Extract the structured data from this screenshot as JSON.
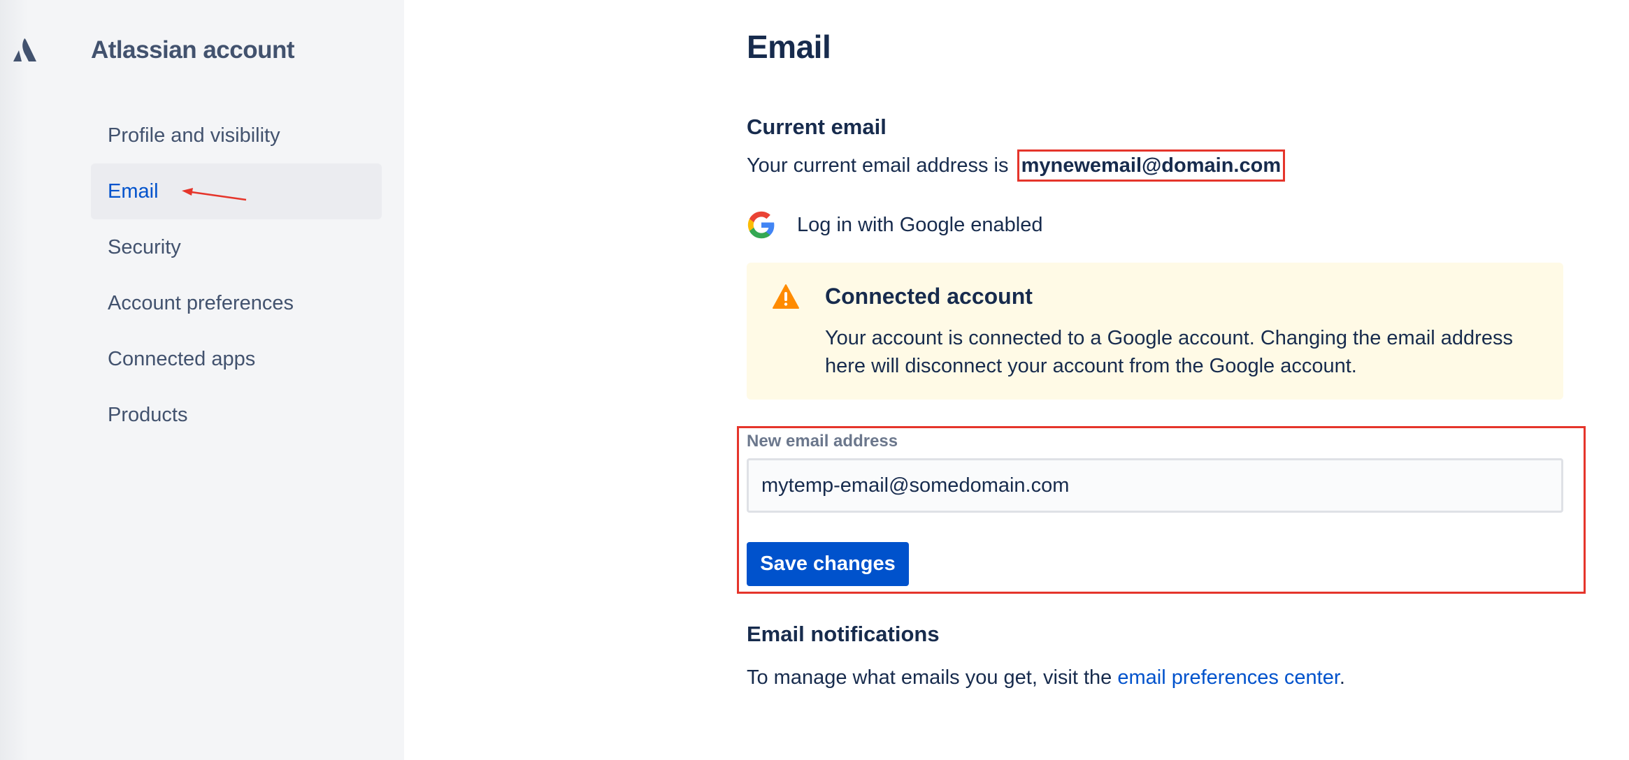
{
  "sidebar": {
    "brand": "Atlassian account",
    "items": [
      {
        "label": "Profile and visibility"
      },
      {
        "label": "Email",
        "active": true
      },
      {
        "label": "Security"
      },
      {
        "label": "Account preferences"
      },
      {
        "label": "Connected apps"
      },
      {
        "label": "Products"
      }
    ]
  },
  "main": {
    "title": "Email",
    "current": {
      "heading": "Current email",
      "prefix": "Your current email address is",
      "email": "mynewemail@domain.com"
    },
    "google": {
      "label": "Log in with Google enabled"
    },
    "warning": {
      "title": "Connected account",
      "body": "Your account is connected to a Google account. Changing the email address here will disconnect your account from the Google account."
    },
    "form": {
      "label": "New email address",
      "value": "mytemp-email@somedomain.com",
      "save_label": "Save changes"
    },
    "notifications": {
      "heading": "Email notifications",
      "prefix": "To manage what emails you get, visit the",
      "link": "email preferences center",
      "suffix": "."
    }
  },
  "colors": {
    "accent": "#0052cc",
    "annotation": "#e5352b",
    "warning_bg": "#fffae6",
    "warning_icon": "#ff8b00"
  }
}
